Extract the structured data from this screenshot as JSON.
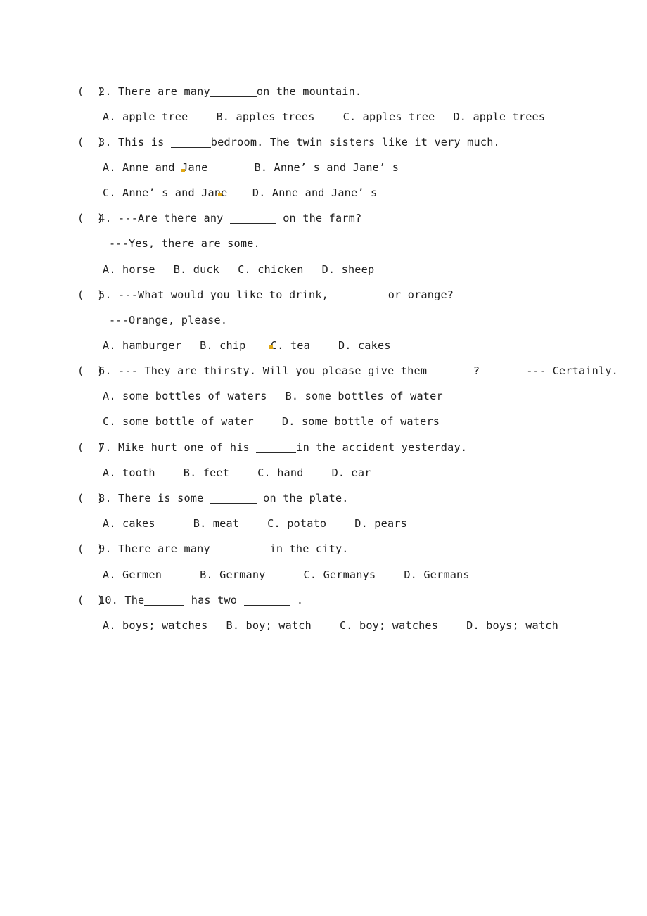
{
  "document": {
    "type": "english-grammar-multiple-choice-worksheet",
    "blank_symbol": "______",
    "choice_marker": "(  )",
    "text_color": "#1f1f1f",
    "annotation_color": "#e0a712",
    "questions": [
      {
        "number": "2.",
        "stem_before_blank": "There are many",
        "stem_after_blank": "on the mountain.",
        "option_rows": [
          [
            {
              "label": "A.",
              "text": "apple tree"
            },
            {
              "label": "B.",
              "text": "apples trees"
            },
            {
              "label": "C.",
              "text": "apples tree"
            },
            {
              "label": "D.",
              "text": "apple trees"
            }
          ]
        ]
      },
      {
        "number": "3.",
        "stem_before_blank": "This is ",
        "stem_after_blank": "bedroom. The twin sisters like it very much.",
        "option_rows": [
          [
            {
              "label": "A.",
              "text": "Anne and Jane"
            },
            {
              "label": "B.",
              "text": "Anne’ s and Jane’ s"
            }
          ],
          [
            {
              "label": "C.",
              "text": "Anne’ s and Jane "
            },
            {
              "label": "D.",
              "text": "Anne and Jane’ s"
            }
          ]
        ]
      },
      {
        "number": "4.",
        "stem_before_blank": "---Are there any ",
        "stem_after_blank": " on the farm?",
        "dialogue_line": "---Yes, there are some.",
        "option_rows": [
          [
            {
              "label": "A.",
              "text": "horse"
            },
            {
              "label": "B.",
              "text": "duck"
            },
            {
              "label": "C.",
              "text": "chicken"
            },
            {
              "label": "D.",
              "text": "sheep"
            }
          ]
        ]
      },
      {
        "number": "5.",
        "stem_before_blank": "---What would you like to drink, ",
        "stem_after_blank": " or orange?",
        "dialogue_line": "---Orange, please.",
        "option_rows": [
          [
            {
              "label": "A.",
              "text": "hamburger"
            },
            {
              "label": "B.",
              "text": "chip "
            },
            {
              "label": "C.",
              "text": "tea"
            },
            {
              "label": "D.",
              "text": "cakes"
            }
          ]
        ]
      },
      {
        "number": "6.",
        "stem_before_blank": "--- They are thirsty. Will you please give them ",
        "stem_after_blank": " ?",
        "stem_trailing": "--- Certainly.",
        "option_rows": [
          [
            {
              "label": "A.",
              "text": "some bottles of waters"
            },
            {
              "label": "B.",
              "text": "some bottles of water"
            }
          ],
          [
            {
              "label": "C.",
              "text": "some bottle of water"
            },
            {
              "label": "D.",
              "text": "some bottle of waters"
            }
          ]
        ]
      },
      {
        "number": "7.",
        "stem_before_blank": "Mike hurt one of his ",
        "stem_after_blank": "in the accident yesterday.",
        "option_rows": [
          [
            {
              "label": "A.",
              "text": "tooth"
            },
            {
              "label": "B.",
              "text": "feet"
            },
            {
              "label": "C.",
              "text": "hand"
            },
            {
              "label": "D.",
              "text": "ear"
            }
          ]
        ]
      },
      {
        "number": "8.",
        "stem_before_blank": "There is some ",
        "stem_after_blank": " on the plate.",
        "option_rows": [
          [
            {
              "label": "A.",
              "text": "cakes"
            },
            {
              "label": "B.",
              "text": "meat"
            },
            {
              "label": "C.",
              "text": "potato"
            },
            {
              "label": "D.",
              "text": "pears"
            }
          ]
        ]
      },
      {
        "number": "9.",
        "stem_before_blank": "There are many ",
        "stem_after_blank": " in the city.",
        "option_rows": [
          [
            {
              "label": "A.",
              "text": "Germen"
            },
            {
              "label": "B.",
              "text": "Germany"
            },
            {
              "label": "C.",
              "text": "Germanys"
            },
            {
              "label": "D.",
              "text": "Germans"
            }
          ]
        ]
      },
      {
        "number": "10.",
        "stem_before_blank": "The",
        "stem_middle": " has two ",
        "stem_after_blank": " .",
        "option_rows": [
          [
            {
              "label": "A.",
              "text": "boys; watches"
            },
            {
              "label": "B.",
              "text": "boy; watch"
            },
            {
              "label": "C.",
              "text": "boy; watches"
            },
            {
              "label": "D.",
              "text": "boys; watch"
            }
          ]
        ]
      }
    ]
  }
}
